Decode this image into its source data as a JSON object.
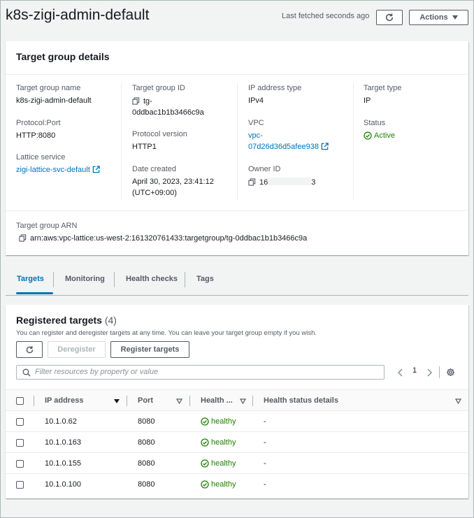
{
  "header": {
    "title": "k8s-zigi-admin-default",
    "last_fetched": "Last fetched seconds ago",
    "actions_label": "Actions"
  },
  "details": {
    "title": "Target group details",
    "target_group_name_label": "Target group name",
    "target_group_name": "k8s-zigi-admin-default",
    "protocol_port_label": "Protocol:Port",
    "protocol_port": "HTTP:8080",
    "lattice_service_label": "Lattice service",
    "lattice_service": "zigi-lattice-svc-default",
    "target_group_id_label": "Target group ID",
    "target_group_id_line1": "tg-",
    "target_group_id_line2": "0ddbac1b1b3466c9a",
    "protocol_version_label": "Protocol version",
    "protocol_version": "HTTP1",
    "date_created_label": "Date created",
    "date_created_line1": "April 30, 2023, 23:41:12",
    "date_created_line2": "(UTC+09:00)",
    "ip_address_type_label": "IP address type",
    "ip_address_type": "IPv4",
    "vpc_label": "VPC",
    "vpc_line1": "vpc-",
    "vpc_line2": "07d26d36d5afee938",
    "owner_id_label": "Owner ID",
    "owner_id_prefix": "16",
    "owner_id_suffix": "3",
    "target_type_label": "Target type",
    "target_type": "IP",
    "status_label": "Status",
    "status": "Active",
    "arn_label": "Target group ARN",
    "arn": "arn:aws:vpc-lattice:us-west-2:161320761433:targetgroup/tg-0ddbac1b1b3466c9a"
  },
  "tabs": [
    "Targets",
    "Monitoring",
    "Health checks",
    "Tags"
  ],
  "targets": {
    "title": "Registered targets",
    "count": "(4)",
    "description": "You can register and deregister targets at any time. You can leave your target group empty if you wish.",
    "deregister_label": "Deregister",
    "register_label": "Register targets",
    "search_placeholder": "Filter resources by property or value",
    "page": "1",
    "columns": [
      "IP address",
      "Port",
      "Health ...",
      "Health status details"
    ],
    "rows": [
      {
        "ip": "10.1.0.62",
        "port": "8080",
        "health": "healthy",
        "details": "-"
      },
      {
        "ip": "10.1.0.163",
        "port": "8080",
        "health": "healthy",
        "details": "-"
      },
      {
        "ip": "10.1.0.155",
        "port": "8080",
        "health": "healthy",
        "details": "-"
      },
      {
        "ip": "10.1.0.100",
        "port": "8080",
        "health": "healthy",
        "details": "-"
      }
    ]
  },
  "colors": {
    "link": "#0073bb",
    "success": "#1d8102",
    "text": "#16191f",
    "muted": "#545b64"
  }
}
